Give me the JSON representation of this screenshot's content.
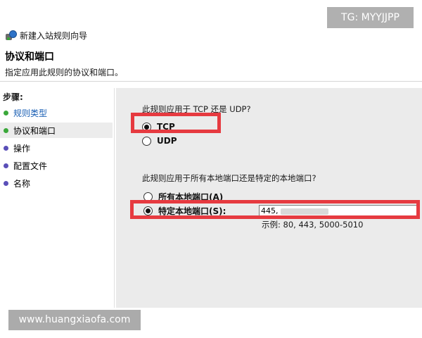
{
  "window": {
    "title": "新建入站规则向导",
    "icon": "firewall-wizard-icon"
  },
  "page": {
    "heading": "协议和端口",
    "subtitle": "指定应用此规则的协议和端口。"
  },
  "steps": {
    "label": "步骤:",
    "items": [
      {
        "label": "规则类型",
        "status": "done",
        "dot_color": "#3aa83a",
        "link": true
      },
      {
        "label": "协议和端口",
        "status": "current",
        "dot_color": "#3aa83a",
        "link": false
      },
      {
        "label": "操作",
        "status": "pending",
        "dot_color": "#5a4fb8",
        "link": false
      },
      {
        "label": "配置文件",
        "status": "pending",
        "dot_color": "#5a4fb8",
        "link": false
      },
      {
        "label": "名称",
        "status": "pending",
        "dot_color": "#5a4fb8",
        "link": false
      }
    ]
  },
  "protocol": {
    "question": "此规则应用于 TCP 还是 UDP?",
    "options": [
      {
        "label": "TCP",
        "selected": true
      },
      {
        "label": "UDP",
        "selected": false
      }
    ]
  },
  "ports": {
    "question": "此规则应用于所有本地端口还是特定的本地端口?",
    "options": [
      {
        "label": "所有本地端口(A)",
        "selected": false
      },
      {
        "label": "特定本地端口(S):",
        "selected": true
      }
    ],
    "value": "445,",
    "example": "示例: 80, 443, 5000-5010"
  },
  "colors": {
    "highlight": "#e63a40",
    "link": "#1a5fb4",
    "panel_bg": "#ebebeb"
  },
  "watermarks": {
    "tg": "TG: MYYJJPP",
    "site": "www.huangxiaofa.com"
  }
}
